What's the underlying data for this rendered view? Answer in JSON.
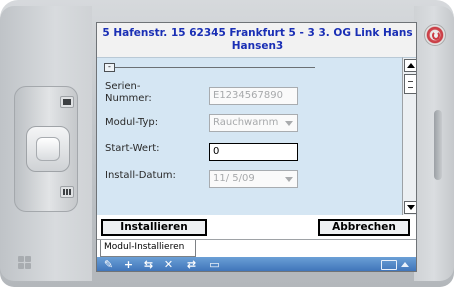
{
  "window": {
    "title_line1": "5  Hafenstr. 15  62345 Frankfurt 5  -  3 3. OG Link Hans",
    "title_line2": "Hansen3"
  },
  "form": {
    "collapse_label": "-",
    "fields": [
      {
        "label": "Serien-\nNummer:",
        "value": "E1234567890",
        "state": "disabled",
        "type": "text"
      },
      {
        "label": "Modul-Typ:",
        "value": "Rauchwarnm",
        "state": "disabled",
        "type": "dropdown"
      },
      {
        "label": "Start-Wert:",
        "value": "0",
        "state": "active",
        "type": "text"
      },
      {
        "label": "Install-Datum:",
        "value": "11/ 5/09",
        "state": "disabled",
        "type": "dropdown"
      }
    ]
  },
  "buttons": {
    "install": "Installieren",
    "cancel": "Abbrechen"
  },
  "tabs": [
    {
      "label": "Modul-Installieren",
      "active": true
    }
  ],
  "toolbar": {
    "icons": [
      "edit-icon",
      "add-icon",
      "install-icon",
      "delete-icon",
      "sync-icon",
      "monitor-icon"
    ],
    "glyphs": [
      "✎",
      "+",
      "⇆",
      "✕",
      "⇄",
      "▭"
    ]
  },
  "colors": {
    "title_text": "#1a2fb5",
    "form_background": "#d5e6f3",
    "toolbar": "#3a6fb6"
  }
}
